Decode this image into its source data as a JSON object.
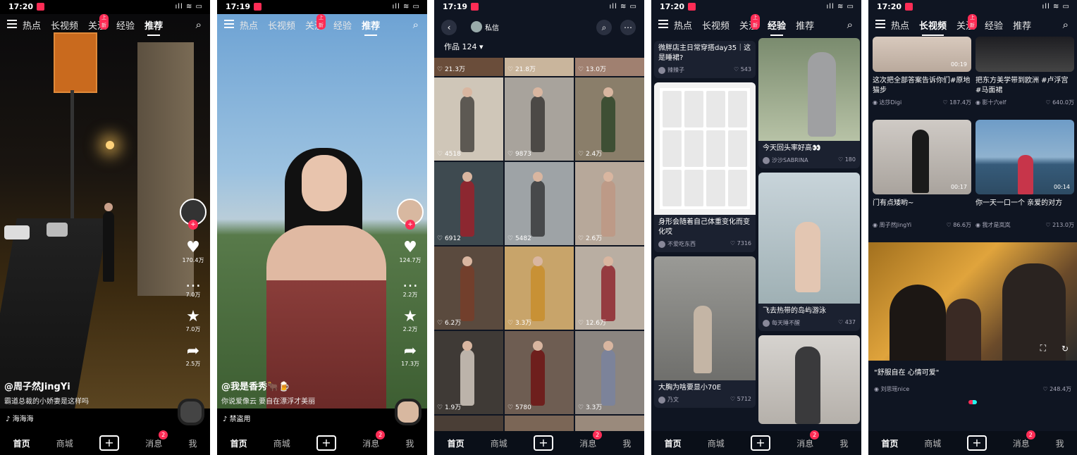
{
  "phone1": {
    "status": {
      "time": "17:20",
      "sys": "ıll ≋ ▭"
    },
    "tabs": [
      "热点",
      "长视频",
      "关注",
      "经验",
      "推荐"
    ],
    "active_tab": "推荐",
    "follow_badge": "上新",
    "counts": {
      "likes": "170.4万",
      "comments": "7.0万",
      "favorites": "7.0万",
      "shares": "2.5万"
    },
    "author": "@周子然JingYi",
    "description": "霸道总裁的小娇妻是这样吗",
    "music": "海海海",
    "nav": [
      "首页",
      "商城",
      "+",
      "消息",
      "我"
    ],
    "msg_badge": "2"
  },
  "phone2": {
    "status": {
      "time": "17:19",
      "sys": "ıll ≋ ▭"
    },
    "tabs": [
      "热点",
      "长视频",
      "关注",
      "经验",
      "推荐"
    ],
    "active_tab": "推荐",
    "follow_badge": "上新",
    "counts": {
      "likes": "124.7万",
      "comments": "2.2万",
      "favorites": "2.2万",
      "shares": "17.3万"
    },
    "author": "@我是香秀🐂🍺",
    "description": "你说爱像云 要自在漂浮才美丽",
    "music": "禁盗用",
    "nav": [
      "首页",
      "商城",
      "+",
      "消息",
      "我"
    ],
    "msg_badge": "2"
  },
  "phone3": {
    "status": {
      "time": "17:19",
      "sys": "ıll ≋ ▭"
    },
    "pm_label": "私信",
    "works_label": "作品 124",
    "grid_top": [
      "21.3万",
      "21.8万",
      "13.0万"
    ],
    "grid": [
      "4518",
      "9873",
      "2.4万",
      "6912",
      "5482",
      "2.6万",
      "6.2万",
      "3.3万",
      "12.6万",
      "1.9万",
      "5780",
      "3.3万",
      "",
      "",
      ""
    ],
    "nav": [
      "首页",
      "商城",
      "+",
      "消息",
      "我"
    ],
    "msg_badge": "2"
  },
  "phone4": {
    "status": {
      "time": "17:20",
      "sys": "ıll ≋ ▭"
    },
    "tabs": [
      "热点",
      "长视频",
      "关注",
      "经验",
      "推荐"
    ],
    "active_tab": "经验",
    "follow_badge": "上新",
    "left_cards": [
      {
        "title": "微胖店主日常穿搭day35｜这是睡裙?",
        "user": "辣辣子",
        "likes": "543"
      },
      {
        "title": "身形会随着自己体重变化而变化哎",
        "user": "不爱吃东西",
        "likes": "7316"
      },
      {
        "title": "大胸为啥要显小70E",
        "user": "乃文",
        "likes": "5712"
      }
    ],
    "right_cards": [
      {
        "title": "今天回头率好高👀",
        "user": "沙沙SABRINA",
        "likes": "180"
      },
      {
        "title": "飞去热带的岛屿游泳",
        "user": "每天睡不醒",
        "likes": "437"
      }
    ],
    "nav": [
      "首页",
      "商城",
      "+",
      "消息",
      "我"
    ],
    "msg_badge": "2"
  },
  "phone5": {
    "status": {
      "time": "17:20",
      "sys": "ıll ≋ ▭"
    },
    "tabs": [
      "热点",
      "长视频",
      "关注",
      "经验",
      "推荐"
    ],
    "active_tab": "长视频",
    "follow_badge": "上新",
    "cards": [
      {
        "title": "这次把全部答案告诉你们#原地猫步",
        "user": "达莎Digi",
        "likes": "187.4万",
        "dur": "00:19"
      },
      {
        "title": "把东方美学带到欧洲 #卢浮宫 #马面裙",
        "user": "影十六elf",
        "likes": "640.0万",
        "dur": ""
      },
      {
        "title": "门有点矮哟~",
        "user": "周子然JingYi",
        "likes": "86.6万",
        "dur": "00:17"
      },
      {
        "title": "你一天一口一个 亲爱的对方",
        "user": "我才是岚岚",
        "likes": "213.0万",
        "dur": "00:14"
      }
    ],
    "big_card": {
      "title": "\"舒服自在 心情可爱\"",
      "user": "刘思瑶nice",
      "likes": "248.4万"
    },
    "nav": [
      "首页",
      "商城",
      "+",
      "消息",
      "我"
    ],
    "msg_badge": "2"
  }
}
